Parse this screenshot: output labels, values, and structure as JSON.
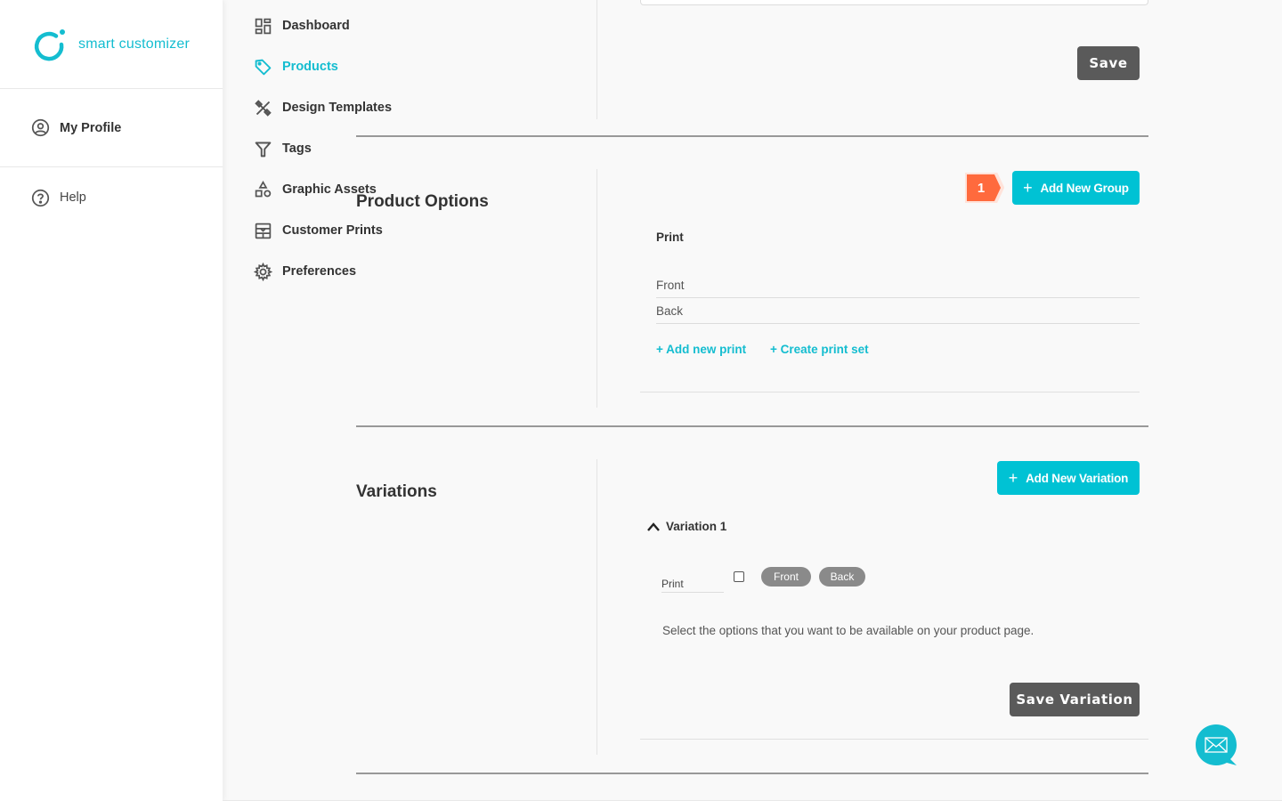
{
  "brand": {
    "name": "smart customizer",
    "accent_color": "#14bdd0",
    "logo_icon": "brand-ring-logo"
  },
  "sidebar": {
    "profile": {
      "label": "My Profile",
      "icon": "user-circle-icon"
    },
    "items": [
      {
        "label": "Dashboard",
        "icon": "dashboard-grid-icon",
        "active": false
      },
      {
        "label": "Products",
        "icon": "tag-icon",
        "active": true
      },
      {
        "label": "Design Templates",
        "icon": "design-tools-icon",
        "active": false
      },
      {
        "label": "Tags",
        "icon": "filter-icon",
        "active": false
      },
      {
        "label": "Graphic Assets",
        "icon": "shapes-icon",
        "active": false
      },
      {
        "label": "Customer Prints",
        "icon": "prints-icon",
        "active": false
      },
      {
        "label": "Preferences",
        "icon": "gear-icon",
        "active": false
      }
    ],
    "help": {
      "label": "Help",
      "icon": "question-circle-icon"
    }
  },
  "top_section": {
    "save_label": "Save"
  },
  "product_options": {
    "title": "Product Options",
    "step_badge": "1",
    "step_badge_color": "#ff6a3d",
    "add_group_label": "Add New Group",
    "group": {
      "name": "Print",
      "options": [
        "Front",
        "Back"
      ]
    },
    "add_print_label": "+ Add new print",
    "create_set_label": "+ Create print set"
  },
  "variations": {
    "title": "Variations",
    "add_variation_label": "Add New Variation",
    "items": [
      {
        "label": "Variation 1",
        "expanded": true,
        "field_label": "Print",
        "checkbox_checked": false,
        "chips": [
          "Front",
          "Back"
        ]
      }
    ],
    "helper_text": "Select the options that you want to be available on your product page.",
    "save_label": "Save Variation"
  },
  "chat": {
    "icon": "envelope-chat-icon"
  }
}
